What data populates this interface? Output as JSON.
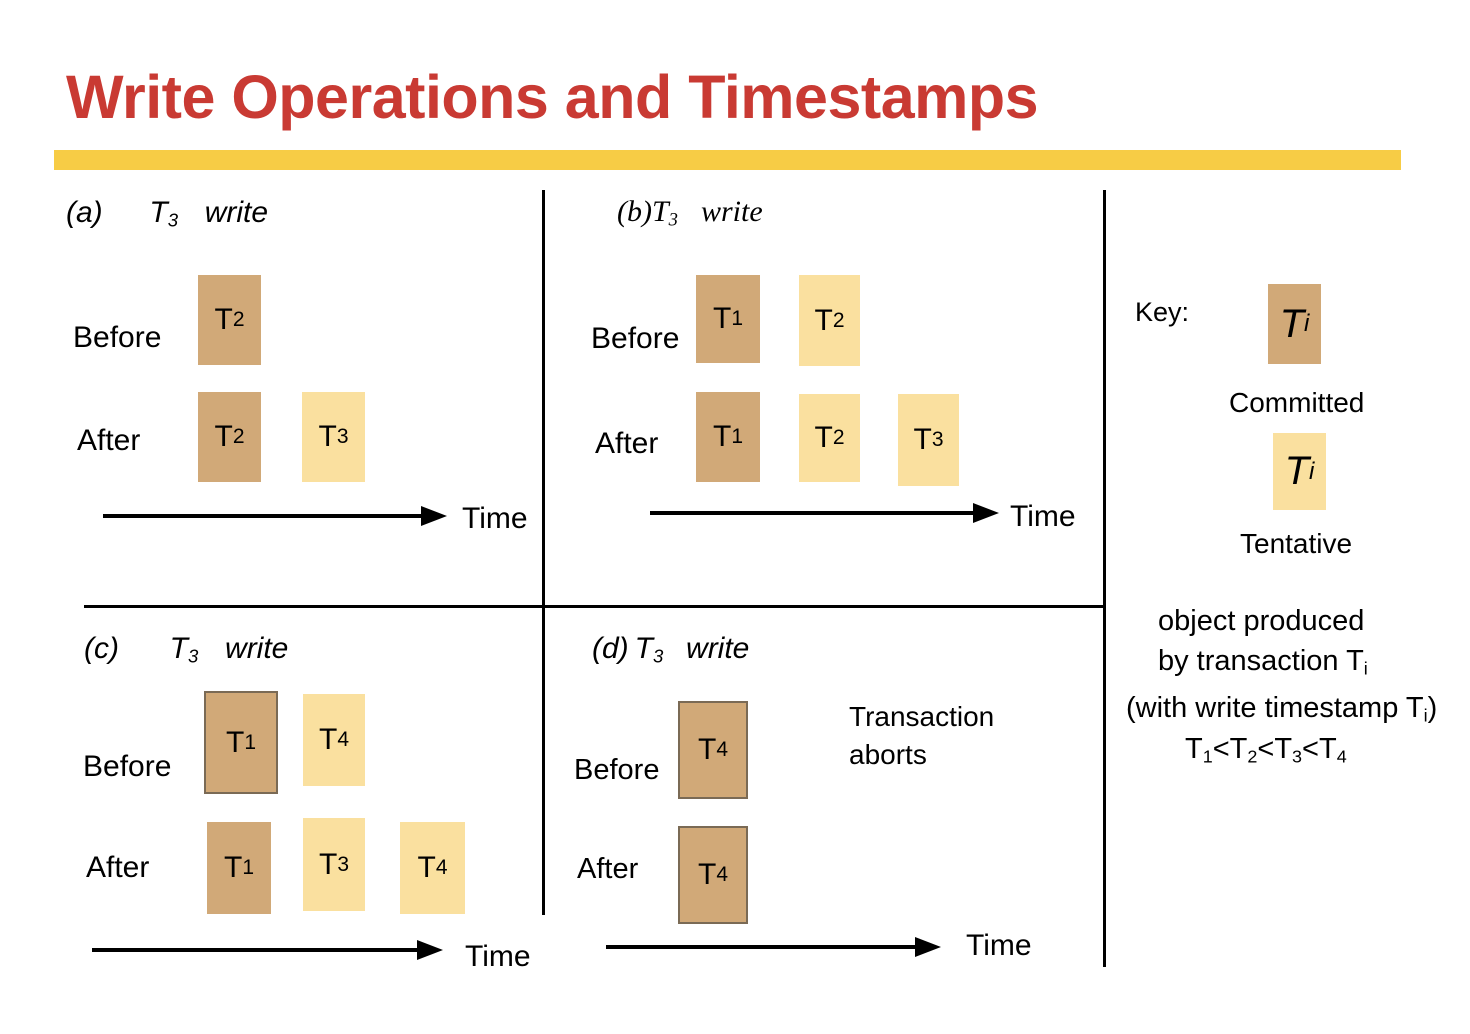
{
  "title": "Write Operations and Timestamps",
  "colors": {
    "committed": "#d1a978",
    "tentative": "#fae09f",
    "title": "#c93a33",
    "rule": "#f7cc45"
  },
  "panels": {
    "a": {
      "tag": "(a)",
      "txn": "T",
      "txn_sub": "3",
      "action": "write",
      "before": "Before",
      "after": "After",
      "time": "Time"
    },
    "b": {
      "tag": "(b)",
      "txn": "T",
      "txn_sub": "3",
      "action": "write",
      "before": "Before",
      "after": "After",
      "time": "Time"
    },
    "c": {
      "tag": "(c)",
      "txn": "T",
      "txn_sub": "3",
      "action": "write",
      "before": "Before",
      "after": "After",
      "time": "Time"
    },
    "d": {
      "tag": "(d)",
      "txn": "T",
      "txn_sub": "3",
      "action": "write",
      "before": "Before",
      "after": "After",
      "time": "Time",
      "note_line1": "Transaction",
      "note_line2": "aborts"
    }
  },
  "boxes": {
    "T": "T",
    "n1": "1",
    "n2": "2",
    "n3": "3",
    "n4": "4"
  },
  "key": {
    "label": "Key:",
    "ti": "T",
    "ti_sub": "i",
    "committed": "Committed",
    "tentative": "Tentative",
    "desc_line1": "object produced",
    "desc_line2": "by transaction T",
    "desc_line2_sub": "i",
    "desc_line3": "(with write timestamp T",
    "desc_line3_sub": "i",
    "desc_line3_end": ")",
    "order": {
      "t": "T",
      "lt": "<",
      "s1": "1",
      "s2": "2",
      "s3": "3",
      "s4": "4"
    }
  }
}
